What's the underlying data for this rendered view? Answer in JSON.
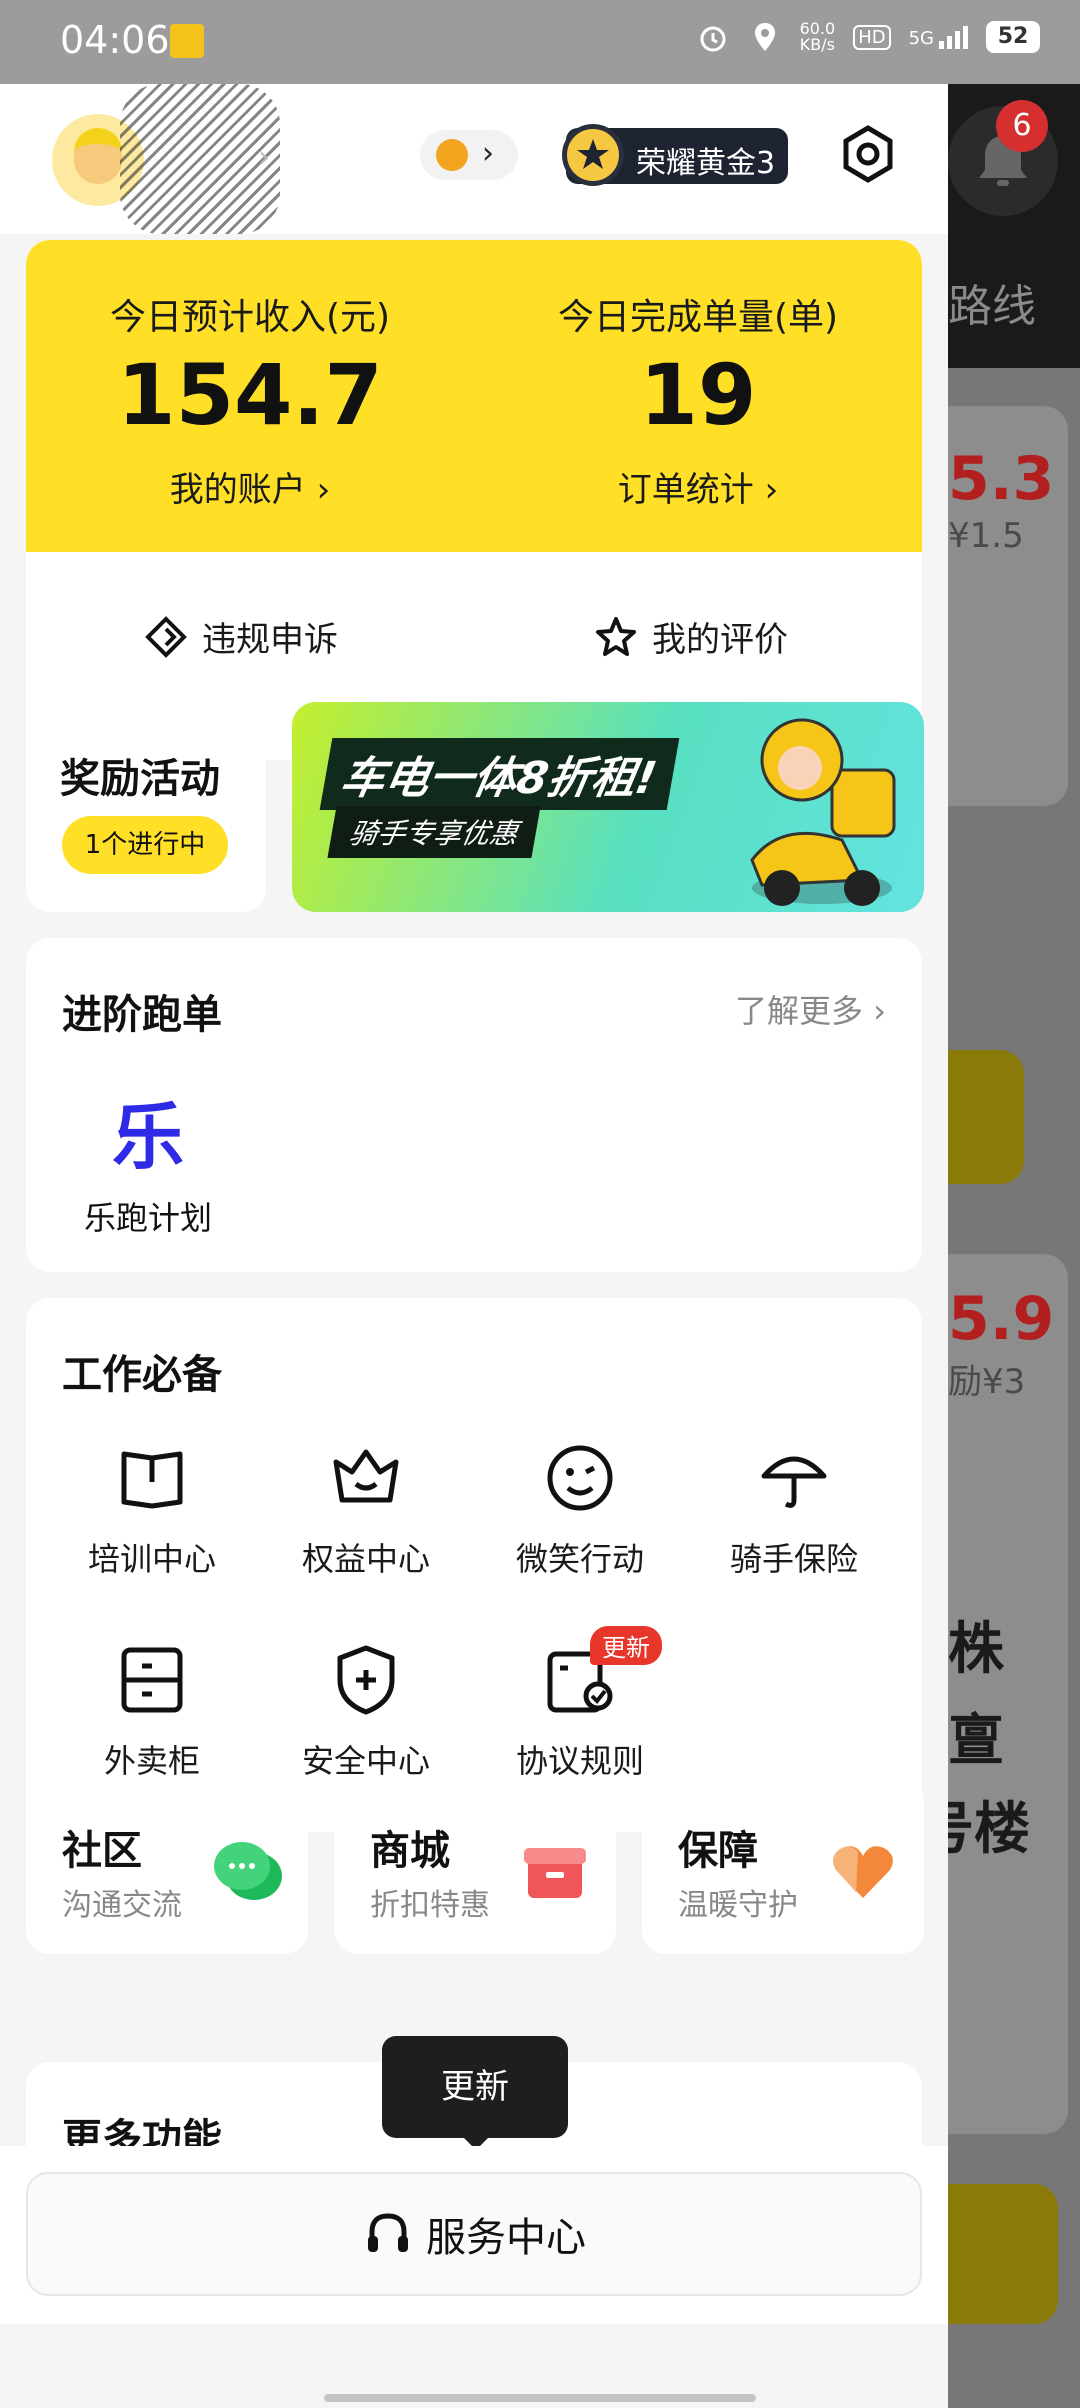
{
  "status_bar": {
    "time": "04:06",
    "net_speed": "60.0",
    "net_unit": "KB/s",
    "hd": "HD",
    "signal": "5G",
    "battery": "52"
  },
  "header": {
    "rank": "荣耀黄金3"
  },
  "earnings": {
    "income_title": "今日预计收入(元)",
    "income_value": "154.7",
    "account_link": "我的账户 ›",
    "orders_title": "今日完成单量(单)",
    "orders_value": "19",
    "orders_link": "订单统计 ›",
    "appeal": "违规申诉",
    "review": "我的评价"
  },
  "rewards": {
    "title": "奖励活动",
    "badge": "1个进行中"
  },
  "banner": {
    "line1": "车电一体8折租!",
    "line2": "骑手专享优惠"
  },
  "advanced": {
    "title": "进阶跑单",
    "more": "了解更多 ›",
    "item_glyph": "乐",
    "item_label": "乐跑计划"
  },
  "work": {
    "title": "工作必备",
    "items": [
      {
        "label": "培训中心",
        "icon": "book-icon"
      },
      {
        "label": "权益中心",
        "icon": "crown-icon"
      },
      {
        "label": "微笑行动",
        "icon": "smile-icon"
      },
      {
        "label": "骑手保险",
        "icon": "umbrella-icon"
      },
      {
        "label": "外卖柜",
        "icon": "locker-icon"
      },
      {
        "label": "安全中心",
        "icon": "shield-icon"
      },
      {
        "label": "协议规则",
        "icon": "agreement-icon",
        "badge": "更新"
      }
    ]
  },
  "mini_cards": [
    {
      "title": "社区",
      "subtitle": "沟通交流",
      "icon": "chat-icon",
      "color": "#2ec46a"
    },
    {
      "title": "商城",
      "subtitle": "折扣特惠",
      "icon": "gift-icon",
      "color": "#f0555a"
    },
    {
      "title": "保障",
      "subtitle": "温暖守护",
      "icon": "heart-icon",
      "color": "#f4883a"
    }
  ],
  "more": {
    "title": "更多功能"
  },
  "tooltip": "更新",
  "service": "服务中心",
  "background": {
    "badge": "6",
    "top_text": "路线",
    "amount1": "5.3",
    "sub1": "¥1.5",
    "amount2": "5.9",
    "sub2": "励¥3",
    "big1": "株",
    "big2": "亶",
    "big3": "号楼"
  },
  "colors": {
    "accent_yellow": "#ffe027",
    "badge_red": "#e8362b",
    "rank_bg": "#1d2330"
  }
}
